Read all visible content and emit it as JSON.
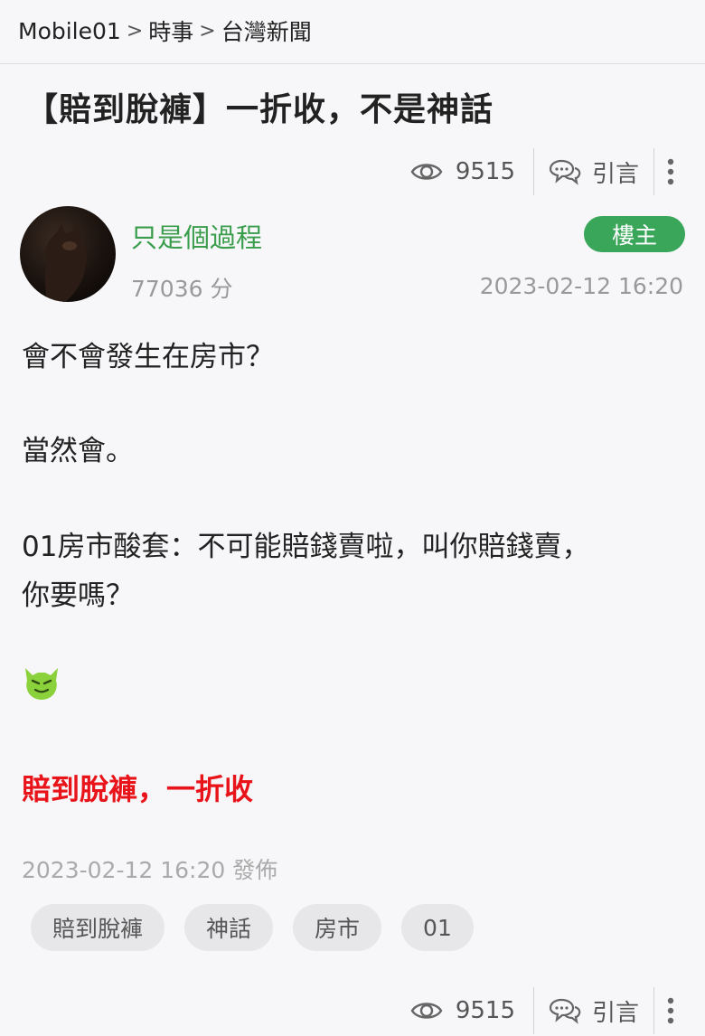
{
  "breadcrumb": {
    "items": [
      "Mobile01",
      "時事",
      "台灣新聞"
    ],
    "separator": ">"
  },
  "post": {
    "title": "【賠到脫褲】一折收，不是神話",
    "views": "9515",
    "quote_label": "引言"
  },
  "author": {
    "name": "只是個過程",
    "points": "77036 分",
    "badge": "樓主",
    "datetime": "2023-02-12 16:20"
  },
  "content": {
    "lines": [
      "會不會發生在房市？",
      "當然會。",
      "01房市酸套：不可能賠錢賣啦，叫你賠錢賣，",
      "你要嗎？"
    ],
    "emoji": "smirking-devil-emoji",
    "highlight": "賠到脫褲，一折收"
  },
  "footer": {
    "posted": "2023-02-12 16:20 發佈",
    "tags": [
      "賠到脫褲",
      "神話",
      "房市",
      "01"
    ],
    "views": "9515",
    "quote_label": "引言"
  },
  "colors": {
    "username": "#3a9d4c",
    "badge": "#3aa65a",
    "highlight": "#e8141a"
  }
}
